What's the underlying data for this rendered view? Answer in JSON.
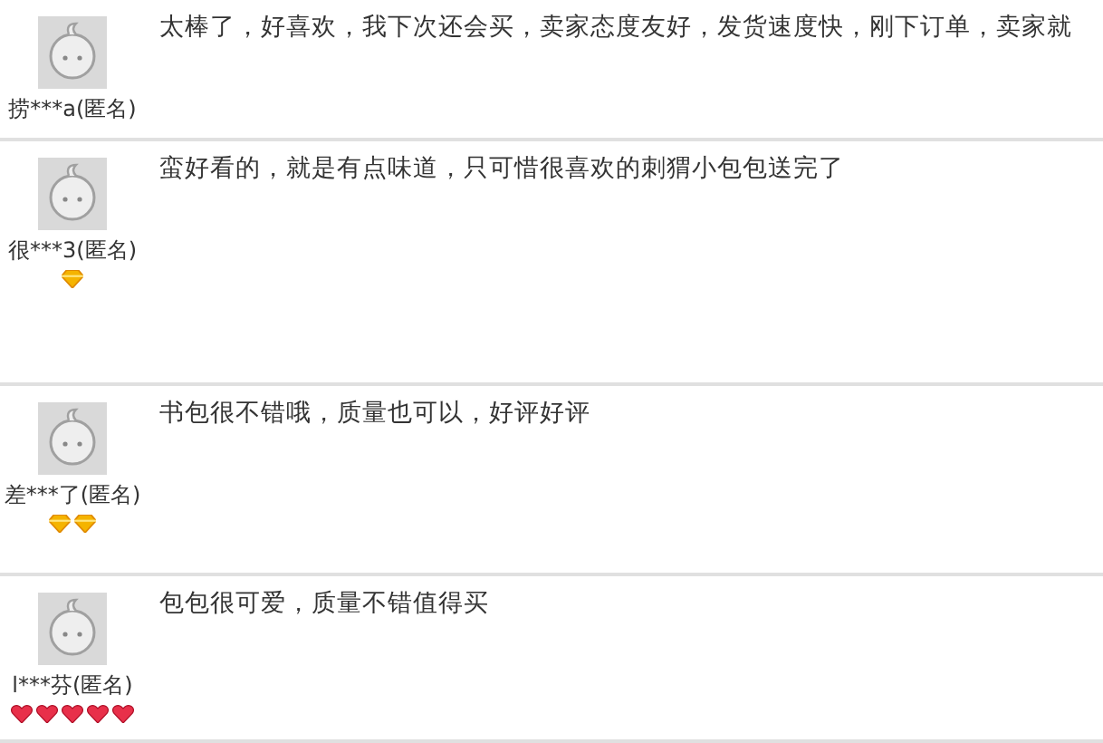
{
  "reviews": [
    {
      "user": "捞***a(匿名)",
      "text": "太棒了，好喜欢，我下次还会买，卖家态度友好，发货速度快，刚下订单，卖家就"
    },
    {
      "user": "很***3(匿名)",
      "text": "蛮好看的，就是有点味道，只可惜很喜欢的刺猬小包包送完了",
      "badges": [
        {
          "kind": "diamond"
        }
      ]
    },
    {
      "user": "差***了(匿名)",
      "text": "书包很不错哦，质量也可以，好评好评",
      "badges": [
        {
          "kind": "diamond"
        },
        {
          "kind": "diamond"
        }
      ]
    },
    {
      "user": "l***芬(匿名)",
      "text": "包包很可爱，质量不错值得买",
      "badges": [
        {
          "kind": "heart"
        },
        {
          "kind": "heart"
        },
        {
          "kind": "heart"
        },
        {
          "kind": "heart"
        },
        {
          "kind": "heart"
        }
      ]
    }
  ]
}
